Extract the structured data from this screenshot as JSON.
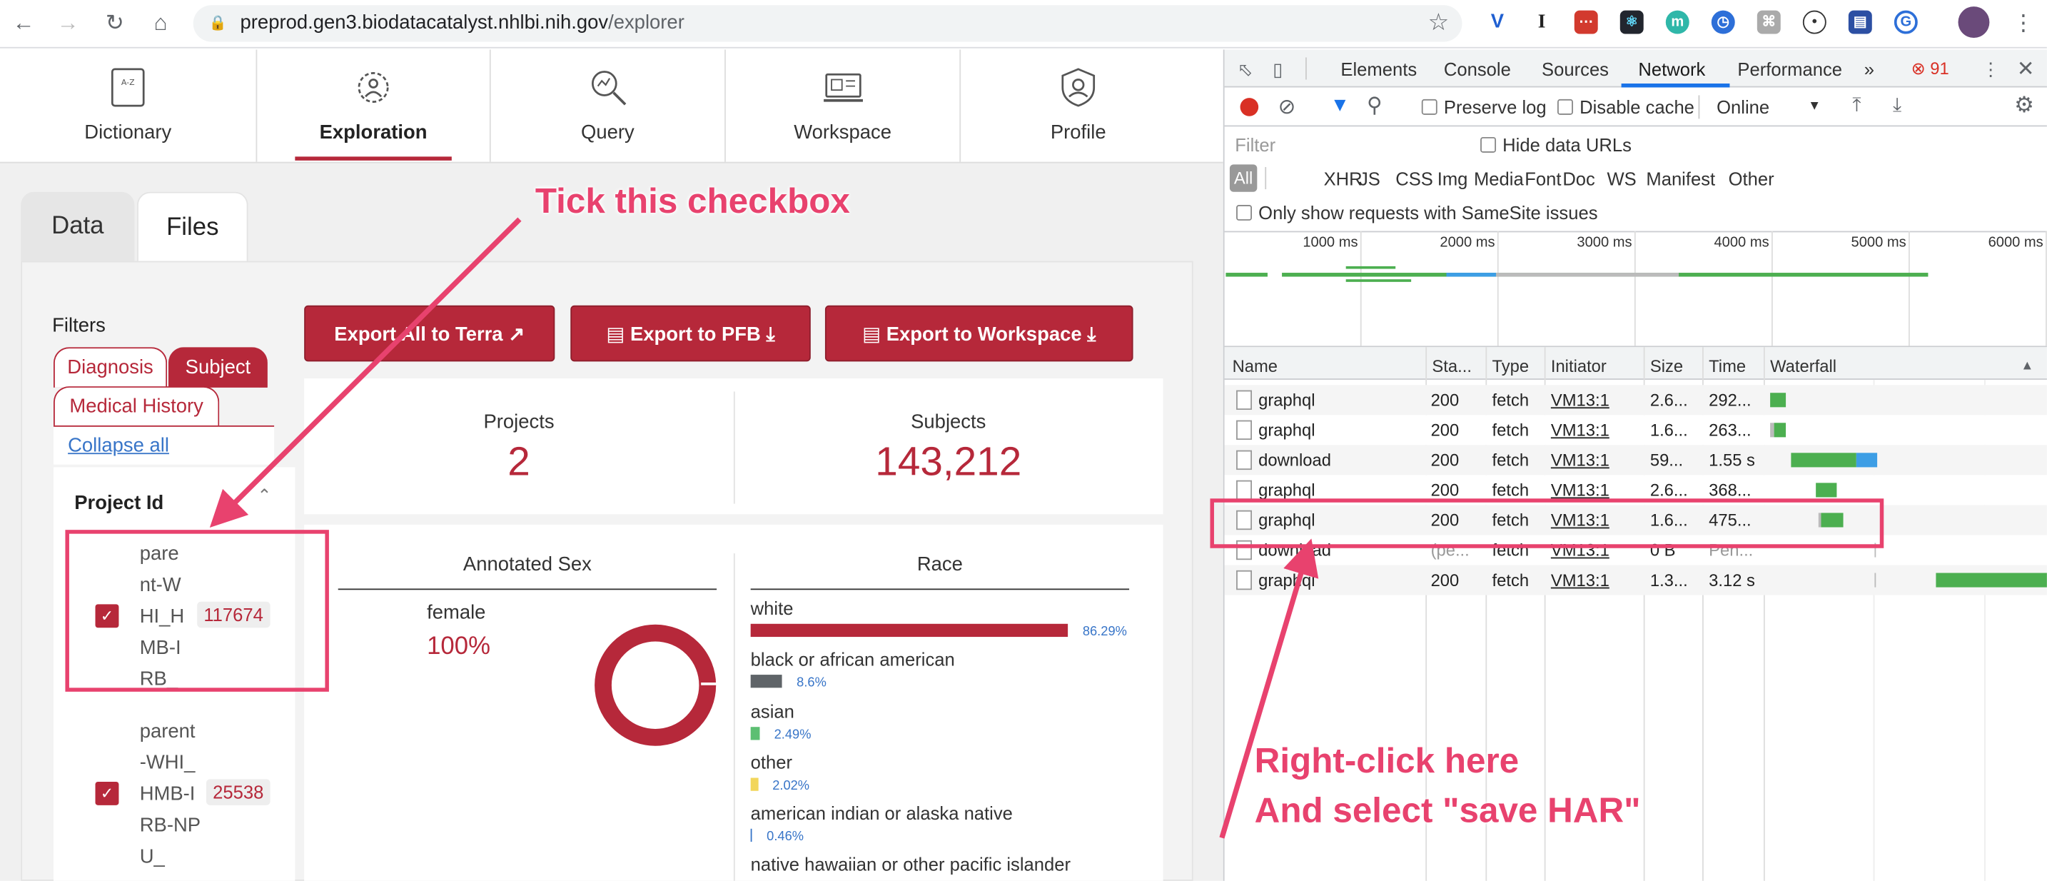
{
  "browser": {
    "url_host": "preprod.gen3.biodatacatalyst.nhlbi.nih.gov",
    "url_path": "/explorer"
  },
  "nav": {
    "tabs": [
      {
        "label": "Dictionary"
      },
      {
        "label": "Exploration"
      },
      {
        "label": "Query"
      },
      {
        "label": "Workspace"
      },
      {
        "label": "Profile"
      }
    ]
  },
  "data_tabs": {
    "data": "Data",
    "files": "Files"
  },
  "filters": {
    "title": "Filters",
    "tabs": [
      "Diagnosis",
      "Subject",
      "Medical History"
    ],
    "collapse_all": "Collapse all",
    "section_title": "Project Id",
    "items": [
      {
        "lines": [
          "pare",
          "nt-W",
          "HI_H",
          "MB-I",
          "RB_"
        ],
        "count": "117674",
        "checked": true
      },
      {
        "lines": [
          "parent",
          "-WHI_",
          "HMB-I",
          "RB-NP",
          "U_"
        ],
        "count": "25538",
        "checked": true
      }
    ]
  },
  "export": {
    "terra": "Export All to Terra",
    "pfb": "Export to PFB",
    "workspace": "Export to Workspace"
  },
  "summary": {
    "projects_label": "Projects",
    "projects_value": "2",
    "subjects_label": "Subjects",
    "subjects_value": "143,212"
  },
  "sex_chart": {
    "title": "Annotated Sex",
    "label": "female",
    "percent": "100%"
  },
  "chart_data": {
    "type": "bar",
    "title": "Race",
    "categories": [
      "white",
      "black or african american",
      "asian",
      "other",
      "american indian or alaska native",
      "native hawaiian or other pacific islander"
    ],
    "values": [
      86.29,
      8.6,
      2.49,
      2.02,
      0.46,
      null
    ],
    "value_labels": [
      "86.29%",
      "8.6%",
      "2.49%",
      "2.02%",
      "0.46%",
      ""
    ],
    "colors": [
      "#b6283a",
      "#5f6468",
      "#5cbf72",
      "#f2d65b",
      "#3875c8",
      "#999999"
    ]
  },
  "devtools": {
    "tabs": [
      "Elements",
      "Console",
      "Sources",
      "Network",
      "Performance"
    ],
    "more": "»",
    "errors": "91",
    "preserve_log": "Preserve log",
    "disable_cache": "Disable cache",
    "throttle": "Online",
    "filter_placeholder": "Filter",
    "hide_data_urls": "Hide data URLs",
    "type_filters": [
      "All",
      "XHR",
      "JS",
      "CSS",
      "Img",
      "Media",
      "Font",
      "Doc",
      "WS",
      "Manifest",
      "Other"
    ],
    "samesite": "Only show requests with SameSite issues",
    "timeline_ticks": [
      "1000 ms",
      "2000 ms",
      "3000 ms",
      "4000 ms",
      "5000 ms",
      "6000 ms"
    ],
    "columns": [
      "Name",
      "Sta...",
      "Type",
      "Initiator",
      "Size",
      "Time",
      "Waterfall"
    ],
    "rows": [
      {
        "name": "graphql",
        "status": "200",
        "type": "fetch",
        "initiator": "VM13:1",
        "size": "2.6...",
        "time": "292..."
      },
      {
        "name": "graphql",
        "status": "200",
        "type": "fetch",
        "initiator": "VM13:1",
        "size": "1.6...",
        "time": "263..."
      },
      {
        "name": "download",
        "status": "200",
        "type": "fetch",
        "initiator": "VM13:1",
        "size": "59...",
        "time": "1.55 s"
      },
      {
        "name": "graphql",
        "status": "200",
        "type": "fetch",
        "initiator": "VM13:1",
        "size": "2.6...",
        "time": "368..."
      },
      {
        "name": "graphql",
        "status": "200",
        "type": "fetch",
        "initiator": "VM13:1",
        "size": "1.6...",
        "time": "475..."
      },
      {
        "name": "download",
        "status": "(pe...",
        "type": "fetch",
        "initiator": "VM13:1",
        "size": "0 B",
        "time": "Pen..."
      },
      {
        "name": "graphql",
        "status": "200",
        "type": "fetch",
        "initiator": "VM13:1",
        "size": "1.3...",
        "time": "3.12 s"
      }
    ]
  },
  "annotations": {
    "tick": "Tick this checkbox",
    "right_click_1": "Right-click here",
    "right_click_2": "And select \"save HAR\""
  }
}
